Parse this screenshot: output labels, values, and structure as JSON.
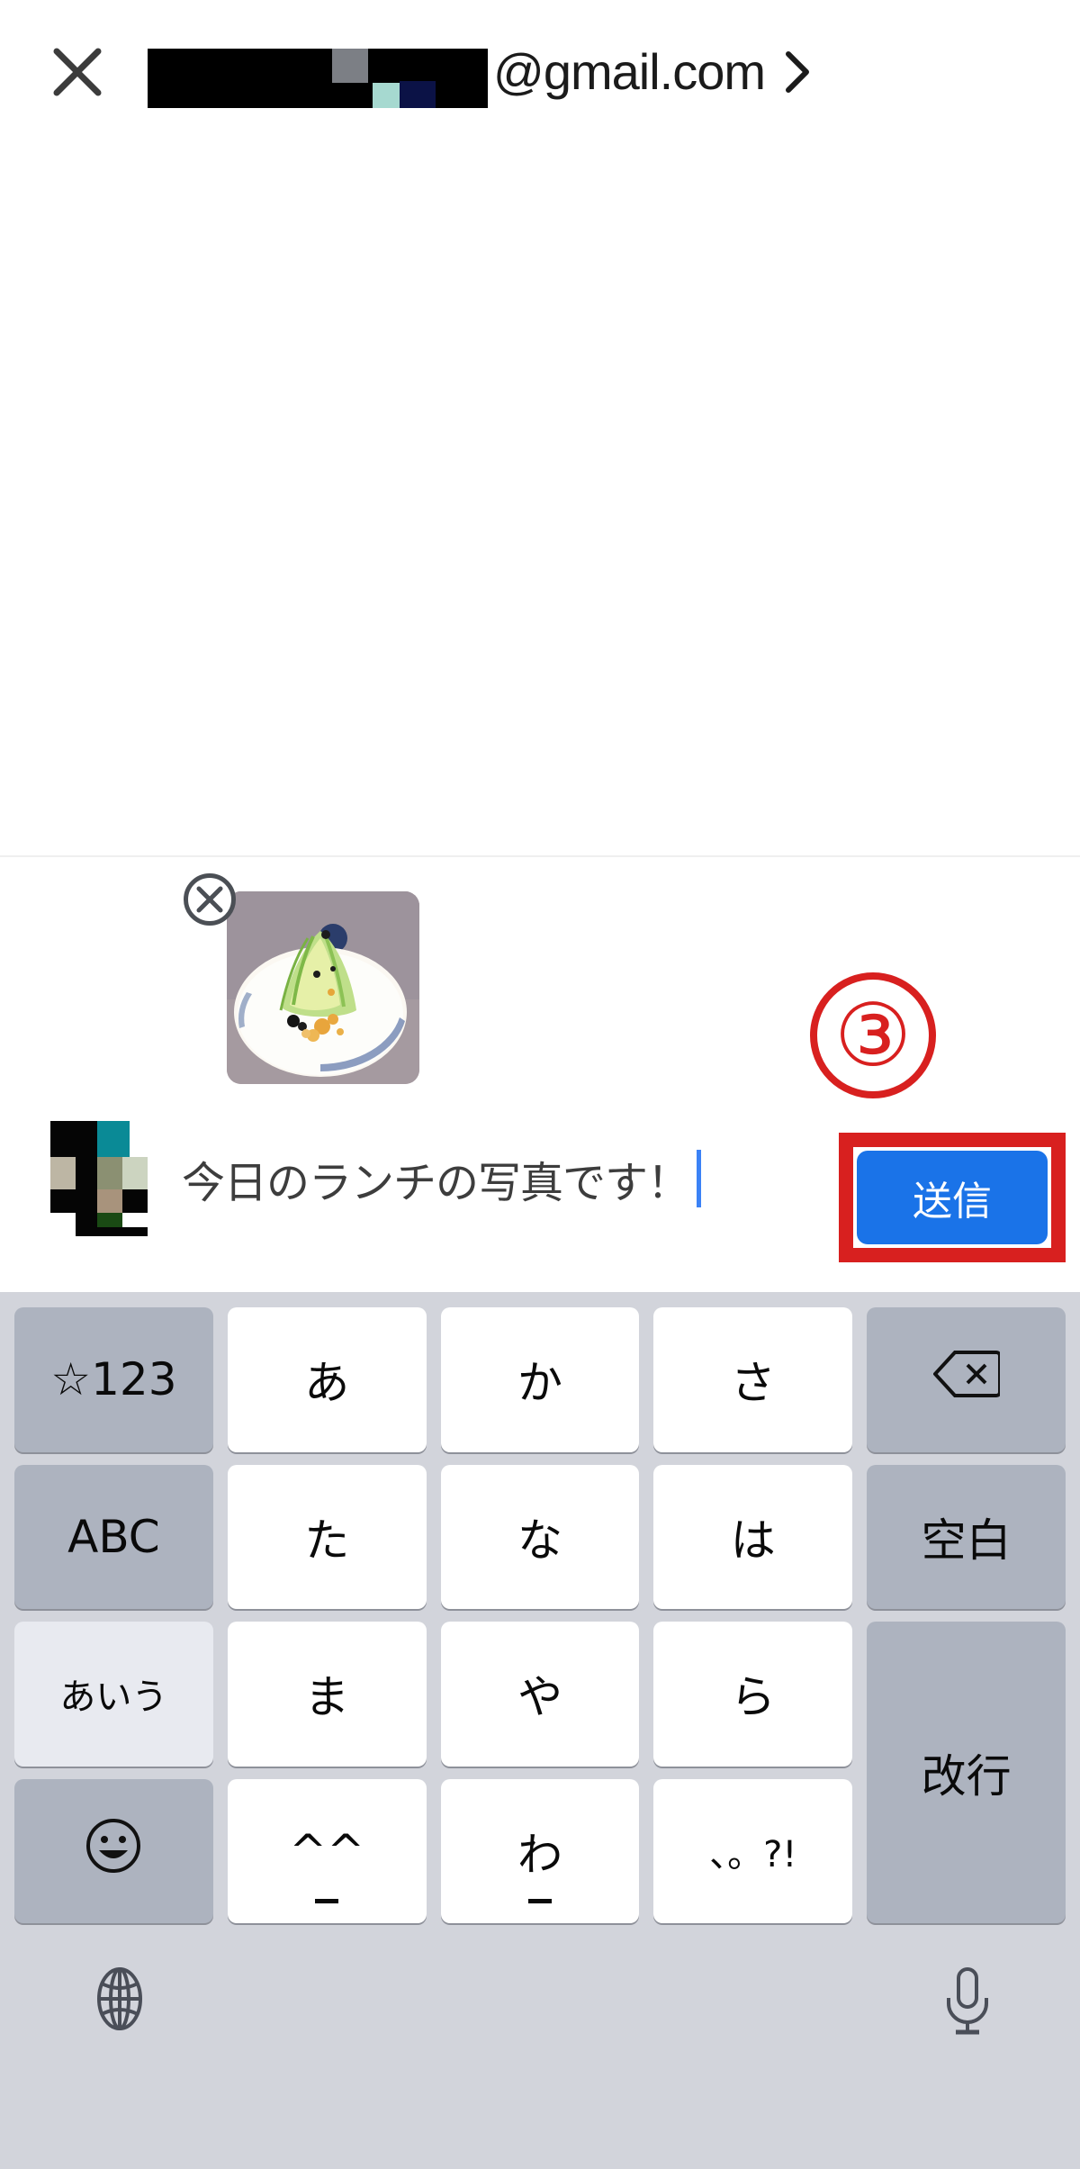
{
  "header": {
    "close_icon": "close-icon",
    "recipient_email_suffix": "@gmail.com",
    "recipient_redacted": true,
    "chevron_icon": "chevron-right-icon"
  },
  "compose": {
    "attachment": {
      "remove_icon": "close-circle-icon",
      "alt": "plate of lettuce salad photo"
    },
    "avatar": "mosaic-redacted-avatar",
    "message_text": "今日のランチの写真です！",
    "caret_visible": true
  },
  "annotation": {
    "step_number": "③",
    "color": "#d8201f"
  },
  "send": {
    "label": "送信",
    "button_color": "#1a73e8",
    "highlight_color": "#d8201f"
  },
  "keyboard": {
    "background": "#d2d4db",
    "key_color": "#ffffff",
    "modifier_color": "#adb3bf",
    "rows": [
      [
        {
          "label": "☆123",
          "type": "mod",
          "name": "key-symbols-123"
        },
        {
          "label": "あ",
          "type": "letter",
          "name": "key-a-row"
        },
        {
          "label": "か",
          "type": "letter",
          "name": "key-ka-row"
        },
        {
          "label": "さ",
          "type": "letter",
          "name": "key-sa-row"
        },
        {
          "label": "",
          "type": "mod",
          "name": "key-backspace",
          "icon": "backspace-icon"
        }
      ],
      [
        {
          "label": "ABC",
          "type": "mod",
          "name": "key-abc"
        },
        {
          "label": "た",
          "type": "letter",
          "name": "key-ta-row"
        },
        {
          "label": "な",
          "type": "letter",
          "name": "key-na-row"
        },
        {
          "label": "は",
          "type": "letter",
          "name": "key-ha-row"
        },
        {
          "label": "空白",
          "type": "mod",
          "name": "key-space"
        }
      ],
      [
        {
          "label": "あいう",
          "type": "light",
          "name": "key-kana-mode"
        },
        {
          "label": "ま",
          "type": "letter",
          "name": "key-ma-row"
        },
        {
          "label": "や",
          "type": "letter",
          "name": "key-ya-row"
        },
        {
          "label": "ら",
          "type": "letter",
          "name": "key-ra-row"
        },
        {
          "label": "改行",
          "type": "mod",
          "name": "key-return",
          "tall": true
        }
      ],
      [
        {
          "label": "",
          "type": "mod",
          "name": "key-emoji",
          "icon": "smiley-icon"
        },
        {
          "label": "^^",
          "type": "letter",
          "name": "key-kaomoji",
          "underbar": true
        },
        {
          "label": "わ",
          "type": "letter",
          "name": "key-wa-row",
          "underbar": true
        },
        {
          "label": "、。?!",
          "type": "letter",
          "name": "key-punctuation",
          "small": true
        }
      ]
    ],
    "bottom_bar": {
      "globe_icon": "globe-icon",
      "mic_icon": "microphone-icon"
    }
  }
}
